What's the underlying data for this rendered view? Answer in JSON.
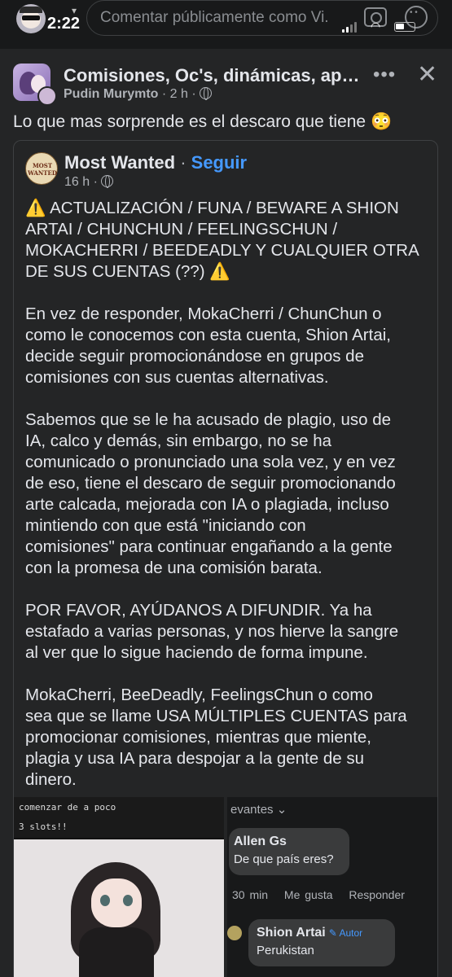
{
  "status_bar": {
    "time": "2:22",
    "comment_placeholder": "Comentar públicamente como Vi..."
  },
  "post": {
    "group_name": "Comisiones, Oc's, dinámicas, apo...",
    "author": "Pudin Murymto",
    "time_ago": "2 h",
    "text": "Lo que mas sorprende es el descaro que tiene 😳"
  },
  "shared_post": {
    "avatar_text": "MOST WANTED",
    "page_name": "Most Wanted",
    "follow_label": "Seguir",
    "time_ago": "16 h",
    "paragraphs": [
      "⚠️ ACTUALIZACIÓN / FUNA / BEWARE A SHION\nARTAI / CHUNCHUN / FEELINGSCHUN /\nMOKACHERRI / BEEDEADLY Y CUALQUIER OTRA\nDE SUS CUENTAS (??) ⚠️",
      "En vez de responder, MokaCherri / ChunChun o\ncomo le conocemos con esta cuenta, Shion Artai,\ndecide seguir promocionándose en grupos de\ncomisiones con sus cuentas alternativas.",
      "Sabemos que se le ha acusado de plagio, uso de\nIA, calco y demás, sin embargo, no se ha\ncomunicado o pronunciado una sola vez, y en vez\nde eso, tiene el descaro de seguir promocionando\narte calcada, mejorada con IA o plagiada, incluso\nmintiendo con que está \"iniciando con\ncomisiones\" para continuar engañando a la gente\ncon la promesa de una comisión barata.",
      "POR FAVOR, AYÚDANOS A DIFUNDIR. Ya ha\nestafado a varias personas, y nos hierve la sangre\nal ver que lo sigue haciendo de forma impune.",
      "MokaCherri, BeeDeadly, FeelingsChun o como\nsea que se llame USA MÚLTIPLES CUENTAS para\npromocionar comisiones, mientras que miente,\nplagia y usa IA para despojar a la gente de su\ndinero."
    ]
  },
  "photo_left": {
    "caption1": "comenzar de a poco",
    "caption2": "3 slots!!"
  },
  "photo_right": {
    "relevant_label": "evantes",
    "comment1": {
      "name": "Allen Gs",
      "text": "De que país eres?"
    },
    "comment1_actions": {
      "time": "30 min",
      "like": "Me gusta",
      "reply": "Responder"
    },
    "comment2": {
      "name": "Shion Artai",
      "badge": "Autor",
      "text": "Perukistan"
    }
  }
}
